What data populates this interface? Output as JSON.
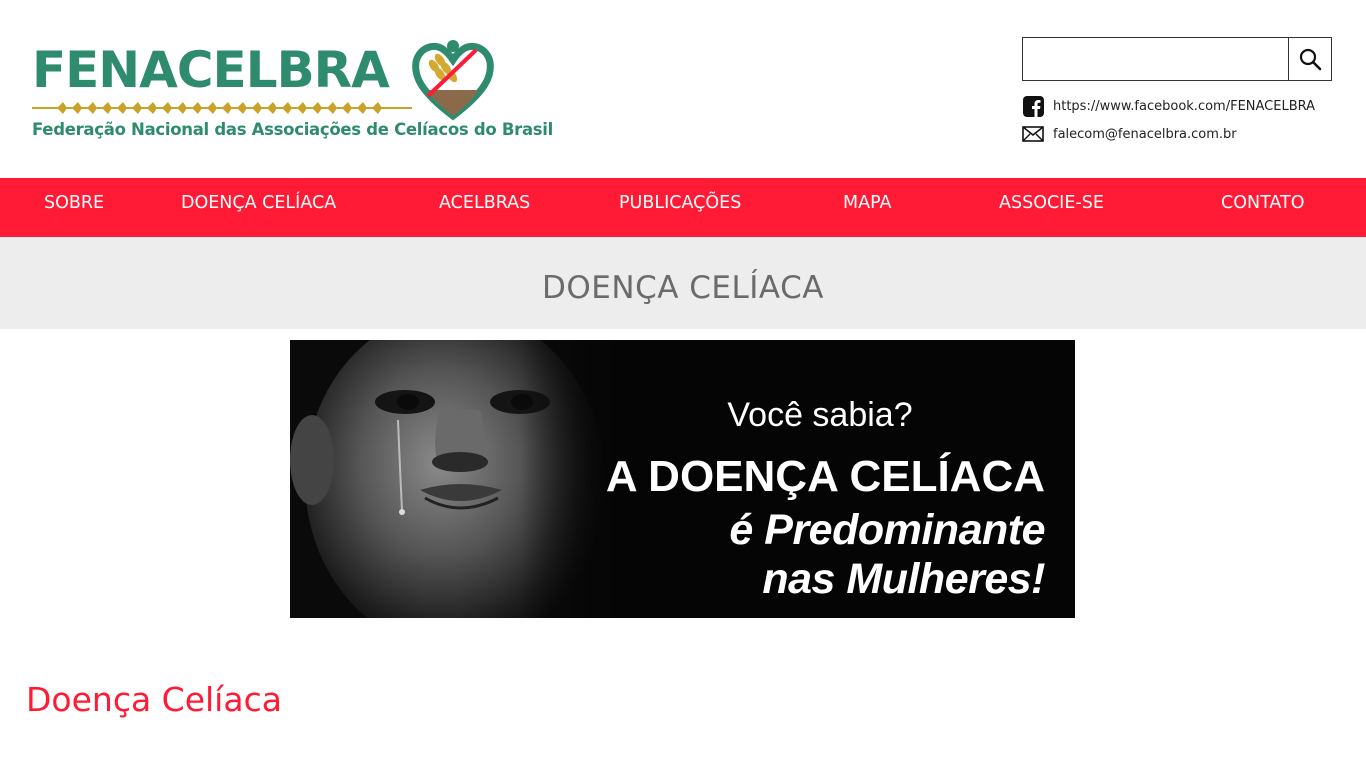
{
  "header": {
    "logo": {
      "title": "FENACELBRA",
      "subtitle": "Federação Nacional das Associações de Celíacos do Brasil"
    },
    "search": {
      "placeholder": "",
      "value": "",
      "icon": "search-icon"
    },
    "facebook": {
      "icon": "facebook-icon",
      "text": "https://www.facebook.com/FENACELBRA"
    },
    "email": {
      "icon": "mail-icon",
      "text": "falecom@fenacelbra.com.br"
    }
  },
  "nav": {
    "items": [
      {
        "label": "SOBRE"
      },
      {
        "label": "DOENÇA CELÍACA"
      },
      {
        "label": "ACELBRAS"
      },
      {
        "label": "PUBLICAÇÕES"
      },
      {
        "label": "MAPA"
      },
      {
        "label": "ASSOCIE-SE"
      },
      {
        "label": "CONTATO"
      }
    ]
  },
  "page": {
    "title": "DOENÇA CELÍACA",
    "banner": {
      "question": "Você sabia?",
      "line1": "A DOENÇA CELÍACA",
      "line2": "é Predominante",
      "line3": "nas Mulheres!"
    },
    "section_heading": "Doença Celíaca"
  },
  "colors": {
    "brand_red": "#ff1a35",
    "brand_green": "#2e8b6e",
    "title_band": "#ededed"
  }
}
